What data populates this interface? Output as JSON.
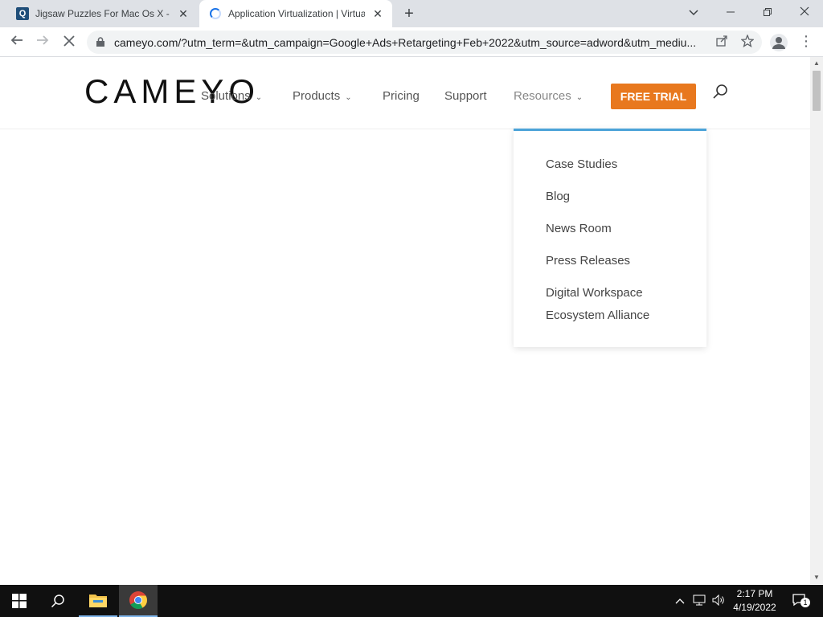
{
  "browser": {
    "tabs": [
      {
        "title": "Jigsaw Puzzles For Mac Os X - do",
        "favicon": "q-square-icon"
      },
      {
        "title": "Application Virtualization | Virtua",
        "favicon": "loading-spinner-icon",
        "active": true
      }
    ],
    "url": "cameyo.com/?utm_term=&utm_campaign=Google+Ads+Retargeting+Feb+2022&utm_source=adword&utm_mediu..."
  },
  "site": {
    "logo_text": "CAMEYO",
    "nav": [
      {
        "label": "Solutions",
        "has_dropdown": true
      },
      {
        "label": "Products",
        "has_dropdown": true
      },
      {
        "label": "Pricing",
        "has_dropdown": false
      },
      {
        "label": "Support",
        "has_dropdown": false
      },
      {
        "label": "Resources",
        "has_dropdown": true
      }
    ],
    "cta_label": "FREE TRIAL",
    "colors": {
      "cta": "#e8781e",
      "dropdown_accent": "#4ba3d8"
    },
    "resources_menu": [
      {
        "label": "Case Studies"
      },
      {
        "label": "Blog"
      },
      {
        "label": "News Room"
      },
      {
        "label": "Press Releases"
      },
      {
        "label": "Digital Workspace Ecosystem Alliance"
      }
    ]
  },
  "taskbar": {
    "time": "2:17 PM",
    "date": "4/19/2022",
    "notification_count": "1"
  }
}
